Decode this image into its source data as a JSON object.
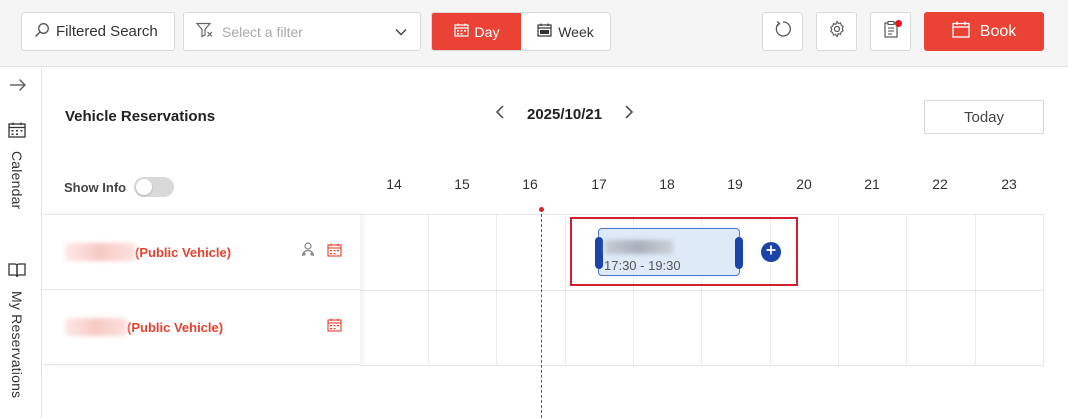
{
  "toolbar": {
    "search_label": "Filtered Search",
    "filter_placeholder": "Select a filter",
    "view_day": "Day",
    "view_week": "Week",
    "book_label": "Book",
    "accent_color": "#ea4335",
    "icons": [
      "search-icon",
      "filter-icon",
      "chevron-down-icon",
      "calendar-icon",
      "week-icon",
      "refresh-icon",
      "gear-icon",
      "clipboard-icon",
      "book-calendar-icon"
    ]
  },
  "rail": {
    "calendar_label": "Calendar",
    "my_reservations_label": "My Reservations"
  },
  "header": {
    "title": "Vehicle Reservations",
    "date": "2025/10/21",
    "today_label": "Today",
    "show_info_label": "Show Info"
  },
  "hours": [
    "14",
    "15",
    "16",
    "17",
    "18",
    "19",
    "20",
    "21",
    "22",
    "23"
  ],
  "vehicles": [
    {
      "suffix": "(Public Vehicle)",
      "has_person_icon": true
    },
    {
      "suffix": "(Public Vehicle)",
      "has_person_icon": false
    }
  ],
  "event": {
    "time": "17:30 - 19:30",
    "color": "#deeaf8"
  }
}
